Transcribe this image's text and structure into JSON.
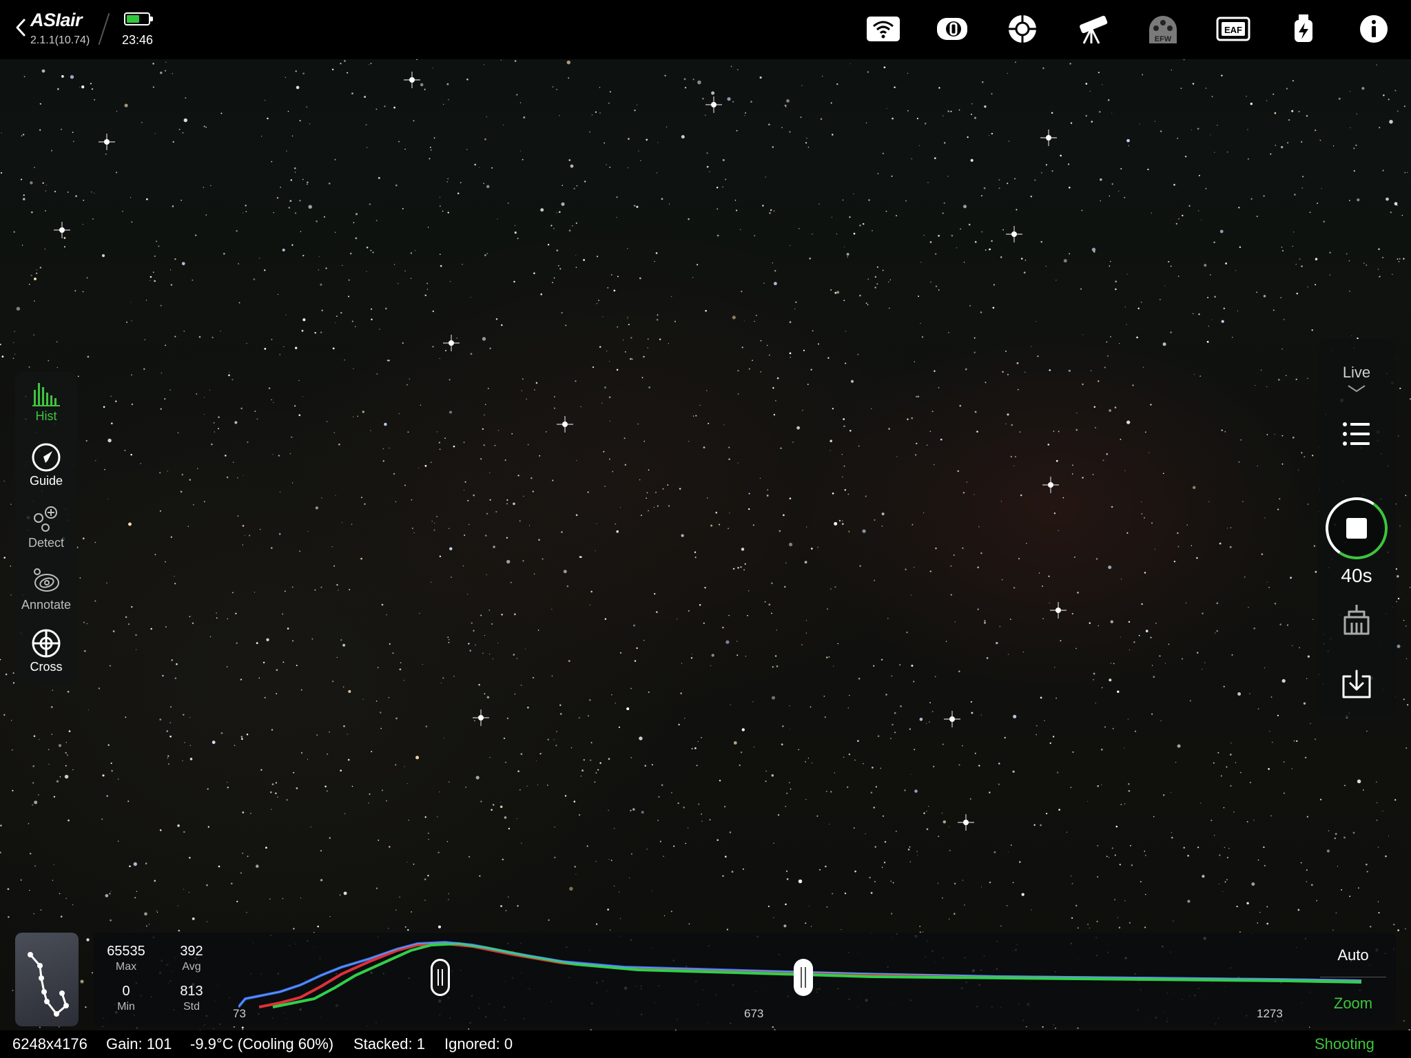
{
  "app": {
    "name": "ASIair",
    "version": "2.1.1(10.74)",
    "time": "23:46",
    "battery_level": 0.6,
    "accent_color": "#3ec53e"
  },
  "top_icons": [
    {
      "name": "wifi-icon"
    },
    {
      "name": "camera-icon"
    },
    {
      "name": "guide-scope-icon"
    },
    {
      "name": "telescope-icon"
    },
    {
      "name": "efw-icon",
      "label": "EFW"
    },
    {
      "name": "eaf-icon",
      "label": "EAF"
    },
    {
      "name": "power-icon"
    },
    {
      "name": "info-icon"
    }
  ],
  "left_tools": [
    {
      "name": "hist",
      "label": "Hist",
      "state": "active"
    },
    {
      "name": "guide",
      "label": "Guide",
      "state": "normal"
    },
    {
      "name": "detect",
      "label": "Detect",
      "state": "dim"
    },
    {
      "name": "annotate",
      "label": "Annotate",
      "state": "dim"
    },
    {
      "name": "cross",
      "label": "Cross",
      "state": "normal"
    }
  ],
  "right_panel": {
    "mode_label": "Live",
    "exposure": "40s"
  },
  "histogram": {
    "max_value": "65535",
    "max_label": "Max",
    "avg_value": "392",
    "avg_label": "Avg",
    "min_value": "0",
    "min_label": "Min",
    "std_value": "813",
    "std_label": "Std",
    "axis_start": "73",
    "axis_mid": "673",
    "axis_end": "1273",
    "auto_label": "Auto",
    "zoom_label": "Zoom"
  },
  "status": {
    "resolution": "6248x4176",
    "gain": "Gain: 101",
    "temperature": "-9.9°C (Cooling 60%)",
    "stacked": "Stacked: 1",
    "ignored": "Ignored: 0",
    "state": "Shooting"
  }
}
